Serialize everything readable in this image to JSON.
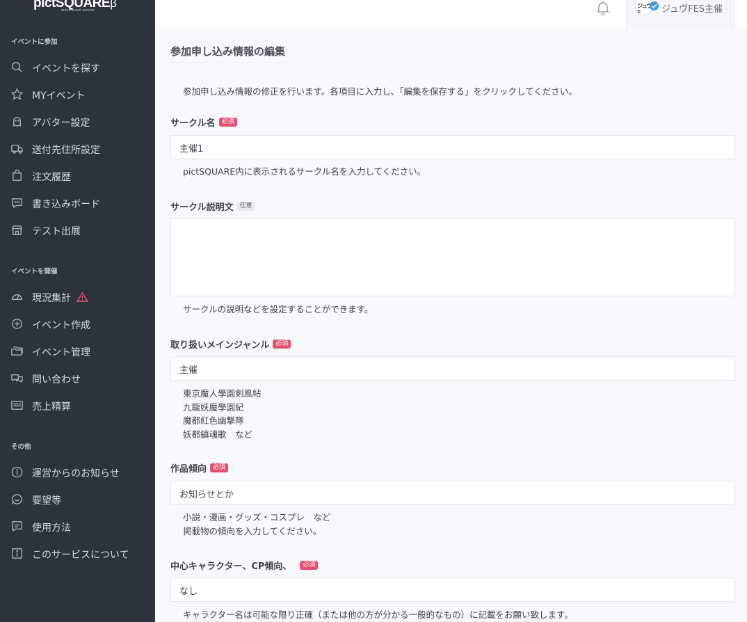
{
  "logo": {
    "text": "pictSQUARE",
    "beta": "β",
    "sub": "make event service"
  },
  "sidebar": {
    "sections": [
      {
        "title": "イベントに参加"
      },
      {
        "title": "イベントを開催"
      },
      {
        "title": "その他"
      }
    ],
    "items": [
      {
        "label": "イベントを探す",
        "icon": "search-icon"
      },
      {
        "label": "MYイベント",
        "icon": "star-icon"
      },
      {
        "label": "アバター設定",
        "icon": "avatar-icon"
      },
      {
        "label": "送付先住所設定",
        "icon": "truck-icon"
      },
      {
        "label": "注文履歴",
        "icon": "shopping-bag-icon"
      },
      {
        "label": "書き込みボード",
        "icon": "chat-icon"
      },
      {
        "label": "テスト出展",
        "icon": "store-icon"
      },
      {
        "label": "現況集計",
        "icon": "gauge-icon",
        "warning": true
      },
      {
        "label": "イベント作成",
        "icon": "plus-circle-icon"
      },
      {
        "label": "イベント管理",
        "icon": "folders-icon"
      },
      {
        "label": "問い合わせ",
        "icon": "chat-bubbles-icon"
      },
      {
        "label": "売上精算",
        "icon": "receipt-icon"
      },
      {
        "label": "運営からのお知らせ",
        "icon": "info-circle-icon"
      },
      {
        "label": "要望等",
        "icon": "smile-chat-icon"
      },
      {
        "label": "使用方法",
        "icon": "message-icon"
      },
      {
        "label": "このサービスについて",
        "icon": "info-box-icon"
      }
    ]
  },
  "header": {
    "user_name": "ジュヴFES主催",
    "avatar_text": "ジュヴF"
  },
  "page": {
    "title": "参加申し込み情報の編集",
    "intro": "参加申し込み情報の修正を行います。各項目に入力し、「編集を保存する」をクリックしてください。"
  },
  "badges": {
    "required": "必須",
    "optional": "任意"
  },
  "fields": {
    "circle_name": {
      "label": "サークル名",
      "value": "主催1",
      "help": "pictSQUARE内に表示されるサークル名を入力してください。"
    },
    "circle_desc": {
      "label": "サークル説明文",
      "value": "",
      "help": "サークルの説明などを設定することができます。"
    },
    "main_genre": {
      "label": "取り扱いメインジャンル",
      "value": "主催",
      "help": [
        "東京魔人學園剣風帖",
        "九龍妖魔學園紀",
        "魔都紅色幽撃隊",
        "妖都鎮魂歌　など"
      ]
    },
    "work_tendency": {
      "label": "作品傾向",
      "value": "お知らせとか",
      "help": [
        "小説・漫画・グッズ・コスプレ　など",
        "掲載物の傾向を入力してください。"
      ]
    },
    "characters": {
      "label": "中心キャラクター、CP傾向、",
      "value": "なし",
      "help": "キャラクター名は可能な限り正確（または他の方が分かる一般的なもの）に記載をお願い致します。"
    }
  },
  "colors": {
    "sidebar_bg": "#2c333d",
    "required_badge": "#e4506e",
    "warning": "#e4506e",
    "verified": "#3f9bd8"
  }
}
